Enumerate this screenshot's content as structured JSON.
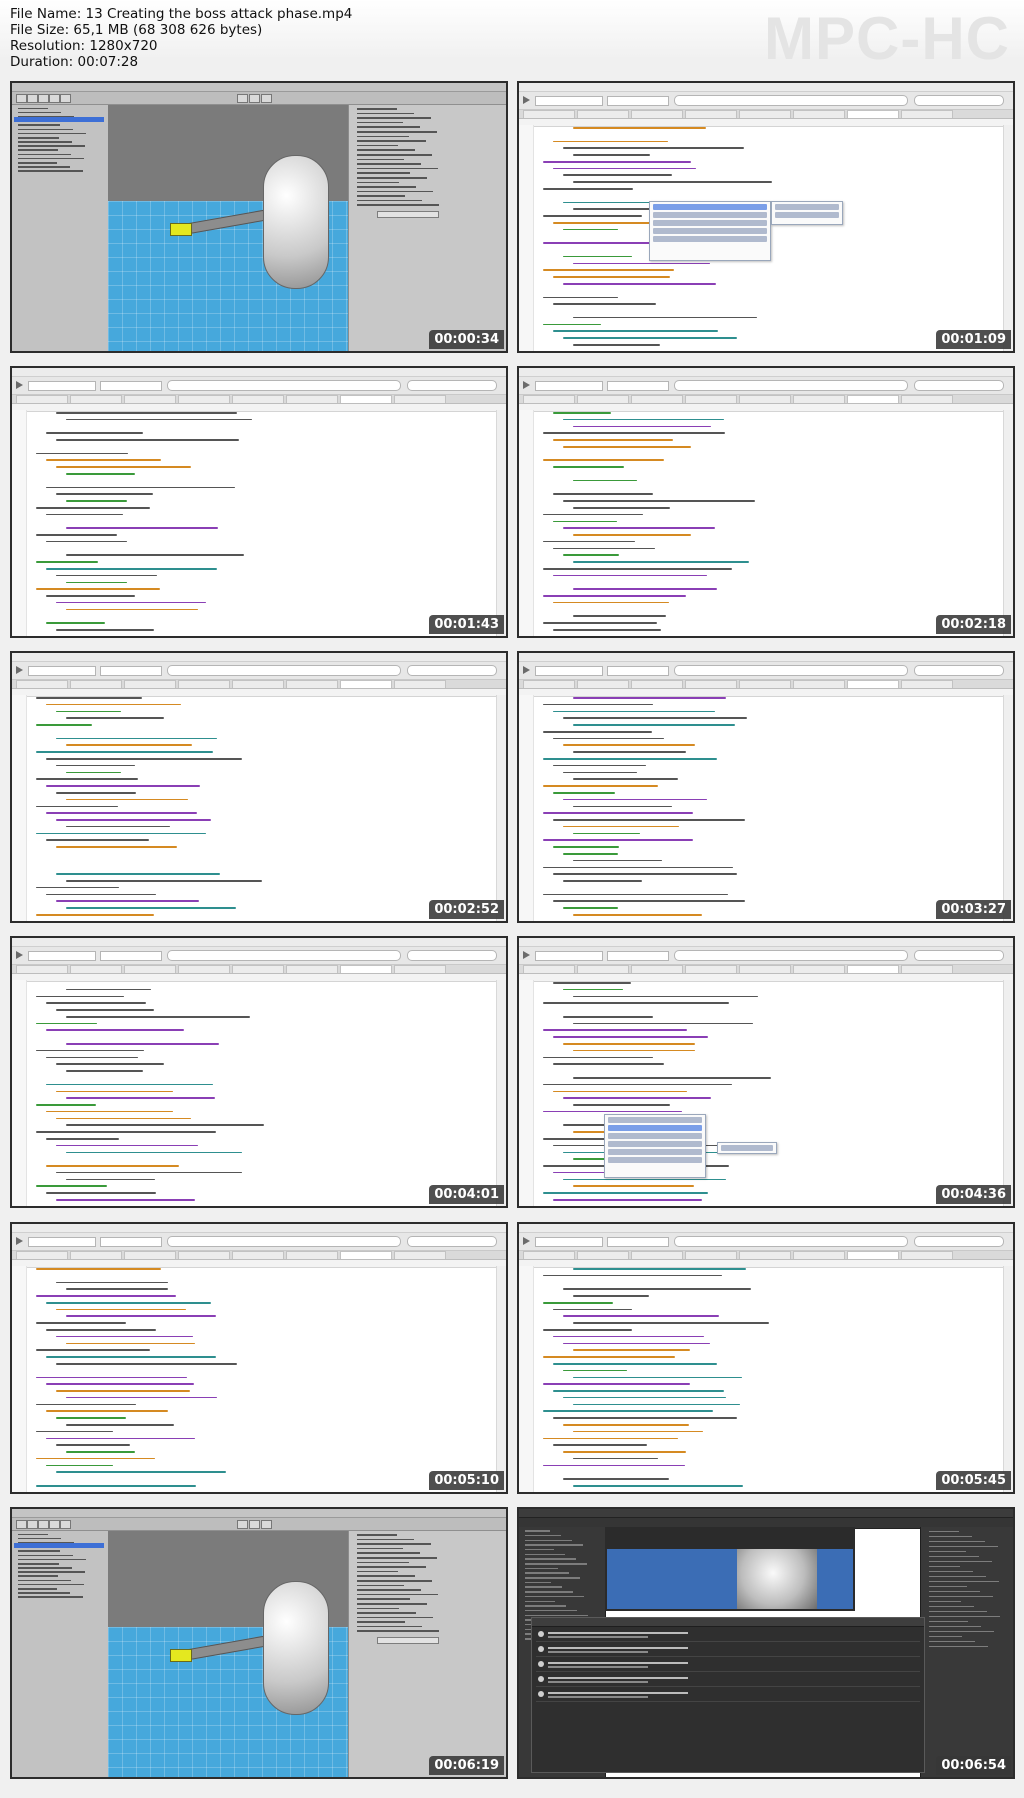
{
  "header": {
    "file_name": "File Name: 13 Creating the boss attack phase.mp4",
    "file_size": "File Size: 65,1 MB (68 308 626 bytes)",
    "resolution": "Resolution: 1280x720",
    "duration": "Duration: 00:07:28"
  },
  "logo": "MPC-HC",
  "thumbnails": [
    {
      "timestamp": "00:00:34",
      "kind": "unity-scene"
    },
    {
      "timestamp": "00:01:09",
      "kind": "code-editor"
    },
    {
      "timestamp": "00:01:43",
      "kind": "code-editor"
    },
    {
      "timestamp": "00:02:18",
      "kind": "code-editor"
    },
    {
      "timestamp": "00:02:52",
      "kind": "code-editor"
    },
    {
      "timestamp": "00:03:27",
      "kind": "code-editor"
    },
    {
      "timestamp": "00:04:01",
      "kind": "code-editor"
    },
    {
      "timestamp": "00:04:36",
      "kind": "code-editor"
    },
    {
      "timestamp": "00:05:10",
      "kind": "code-editor"
    },
    {
      "timestamp": "00:05:45",
      "kind": "code-editor"
    },
    {
      "timestamp": "00:06:19",
      "kind": "unity-scene"
    },
    {
      "timestamp": "00:06:54",
      "kind": "unity-dark-console"
    }
  ]
}
